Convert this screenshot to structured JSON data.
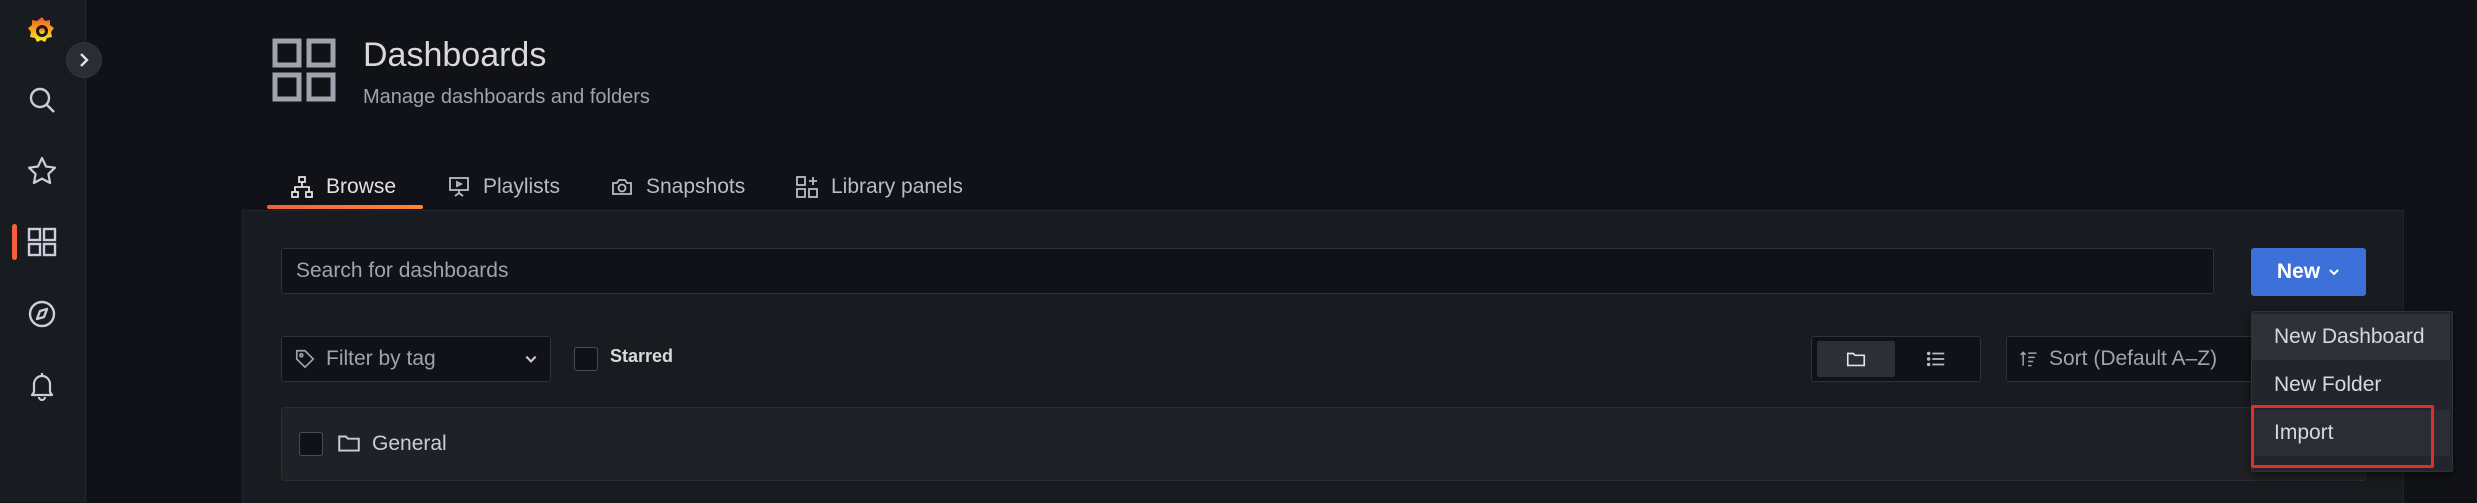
{
  "sidebar": {
    "items": [
      {
        "icon": "grafana-logo-icon"
      },
      {
        "icon": "search-icon"
      },
      {
        "icon": "star-icon"
      },
      {
        "icon": "dashboards-icon",
        "active": true
      },
      {
        "icon": "compass-icon"
      },
      {
        "icon": "bell-icon"
      }
    ],
    "active_color": "#f55f3e"
  },
  "header": {
    "title": "Dashboards",
    "subtitle": "Manage dashboards and folders",
    "icon": "dashboards-icon"
  },
  "tabs": [
    {
      "label": "Browse",
      "icon": "sitemap-icon",
      "active": true
    },
    {
      "label": "Playlists",
      "icon": "presentation-icon"
    },
    {
      "label": "Snapshots",
      "icon": "camera-icon"
    },
    {
      "label": "Library panels",
      "icon": "library-panels-icon"
    }
  ],
  "search": {
    "placeholder": "Search for dashboards",
    "value": ""
  },
  "new_button": {
    "label": "New",
    "color": "#3d71d9"
  },
  "new_menu": {
    "items": [
      "New Dashboard",
      "New Folder",
      "Import"
    ],
    "highlighted": "Import"
  },
  "filters": {
    "tag_placeholder": "Filter by tag",
    "starred_label": "Starred",
    "starred_checked": false,
    "view_mode": "folders",
    "sort_label": "Sort (Default A–Z)"
  },
  "folders": [
    {
      "name": "General"
    }
  ]
}
